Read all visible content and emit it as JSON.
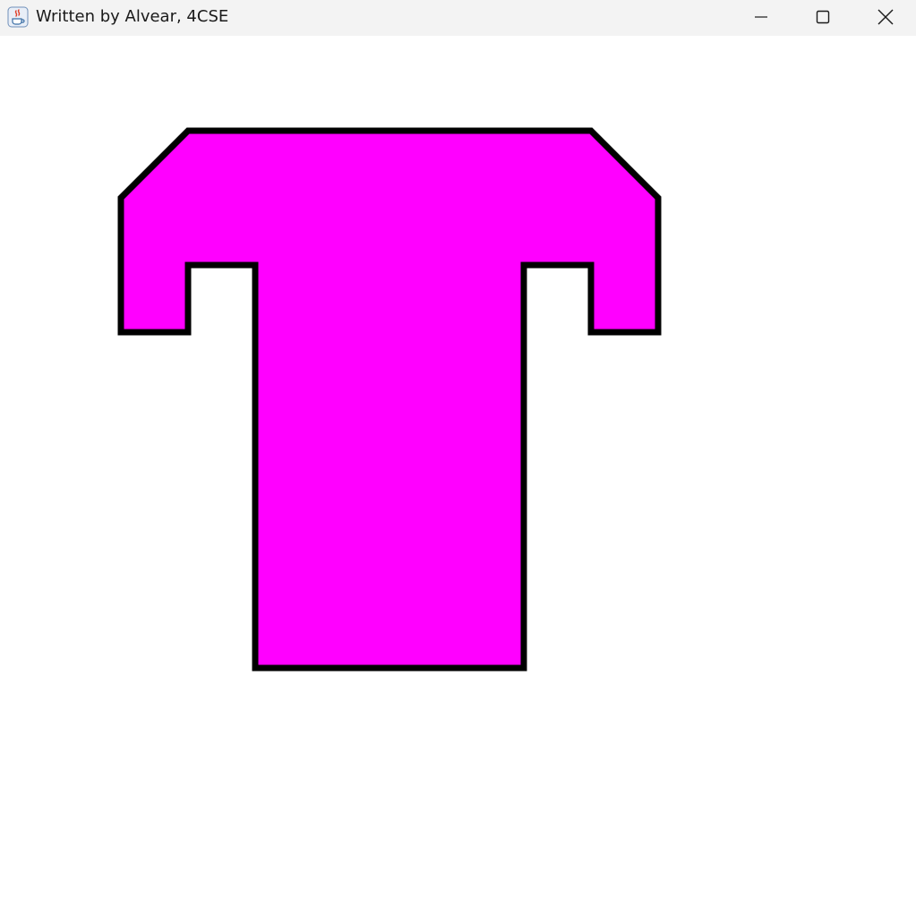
{
  "window": {
    "title": "Written by Alvear, 4CSE",
    "app_icon": "java-coffee-icon",
    "controls": {
      "minimize_icon": "minimize-icon",
      "maximize_icon": "maximize-icon",
      "close_icon": "close-icon"
    }
  },
  "canvas": {
    "background": "#ffffff",
    "shape": {
      "name": "t-shaped-polygon",
      "fill": "#ff00ff",
      "stroke": "#000000"
    }
  }
}
